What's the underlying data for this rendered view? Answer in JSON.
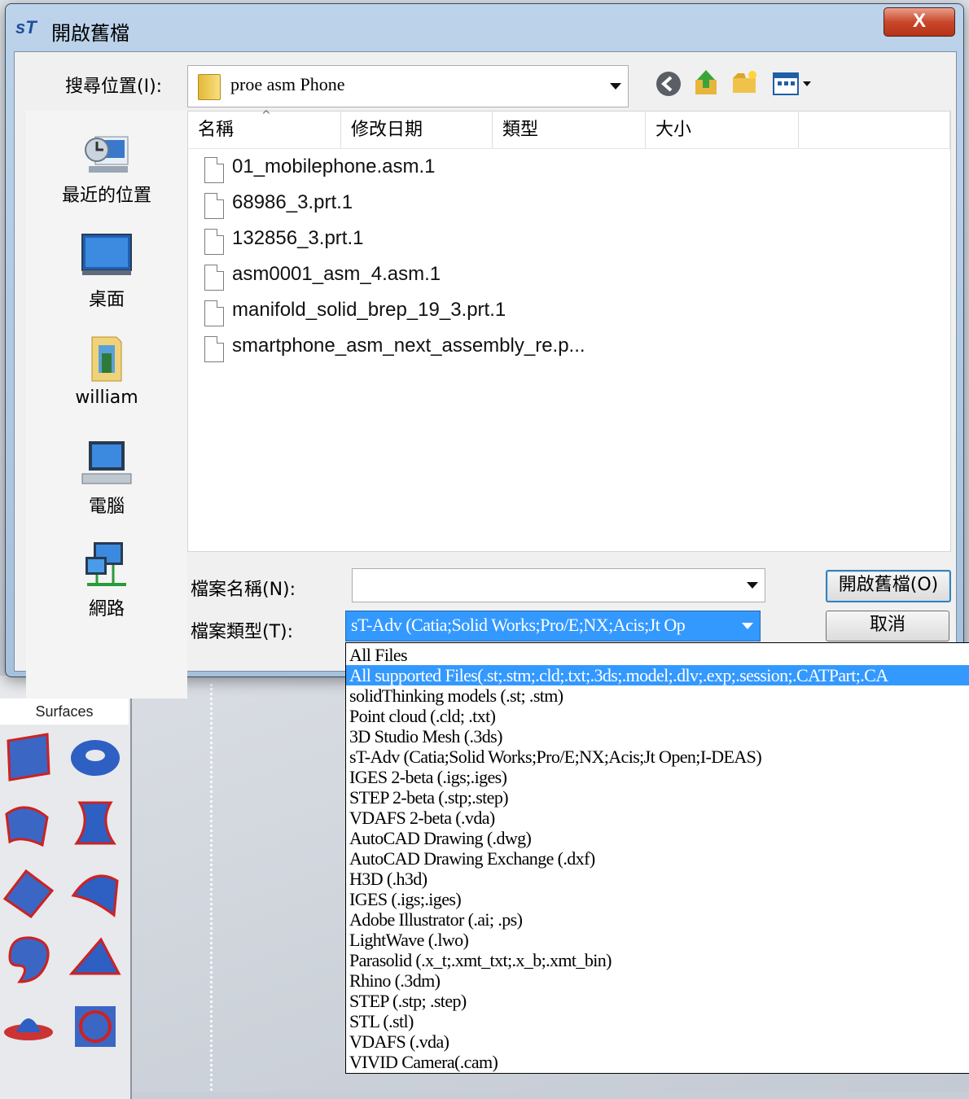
{
  "dialog": {
    "app_logo": "sT",
    "title": "開啟舊檔",
    "close_label": "X"
  },
  "look_in": {
    "label": "搜尋位置(I):",
    "value": "proe asm Phone"
  },
  "places": [
    {
      "label": "最近的位置",
      "icon": "recent-places-icon"
    },
    {
      "label": "桌面",
      "icon": "desktop-icon"
    },
    {
      "label": "william",
      "icon": "user-folder-icon"
    },
    {
      "label": "電腦",
      "icon": "computer-icon"
    },
    {
      "label": "網路",
      "icon": "network-icon"
    }
  ],
  "columns": [
    "名稱",
    "修改日期",
    "類型",
    "大小"
  ],
  "files": [
    "01_mobilephone.asm.1",
    "68986_3.prt.1",
    "132856_3.prt.1",
    "asm0001_asm_4.asm.1",
    "manifold_solid_brep_19_3.prt.1",
    "smartphone_asm_next_assembly_re.p..."
  ],
  "filename": {
    "label": "檔案名稱(N):",
    "value": ""
  },
  "filetype": {
    "label": "檔案類型(T):",
    "value": "sT-Adv (Catia;Solid Works;Pro/E;NX;Acis;Jt Op"
  },
  "buttons": {
    "open": "開啟舊檔(O)",
    "cancel": "取消"
  },
  "filetype_options": [
    "All Files",
    "All supported Files(.st;.stm;.cld;.txt;.3ds;.model;.dlv;.exp;.session;.CATPart;.CA",
    "solidThinking models (.st; .stm)",
    "Point cloud (.cld; .txt)",
    "3D Studio Mesh (.3ds)",
    "sT-Adv (Catia;Solid Works;Pro/E;NX;Acis;Jt Open;I-DEAS)",
    "IGES 2-beta (.igs;.iges)",
    "STEP 2-beta (.stp;.step)",
    "VDAFS 2-beta (.vda)",
    "AutoCAD Drawing (.dwg)",
    "AutoCAD Drawing Exchange (.dxf)",
    "H3D (.h3d)",
    "IGES (.igs;.iges)",
    "Adobe Illustrator (.ai; .ps)",
    "LightWave (.lwo)",
    "Parasolid (.x_t;.xmt_txt;.x_b;.xmt_bin)",
    "Rhino (.3dm)",
    "STEP (.stp; .step)",
    "STL (.stl)",
    "VDAFS (.vda)",
    "VIVID Camera(.cam)"
  ],
  "selected_option_index": 1,
  "background": {
    "palette_label": "Surfaces"
  }
}
